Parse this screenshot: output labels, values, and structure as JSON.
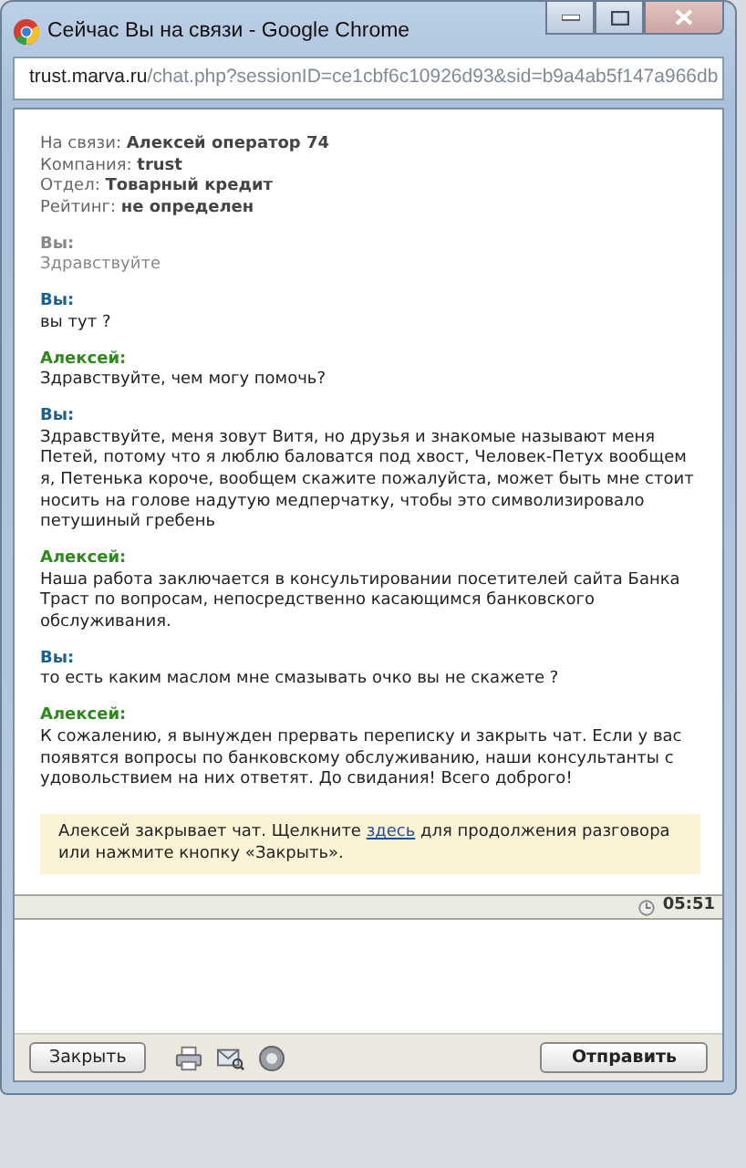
{
  "window": {
    "title": "Сейчас Вы на связи - Google Chrome"
  },
  "address": {
    "host": "trust.marva.ru",
    "path": "/chat.php?sessionID=ce1cbf6c10926d93&sid=b9a4ab5f147a966db"
  },
  "info": [
    {
      "label": "На связи:",
      "value": "Алексей оператор 74"
    },
    {
      "label": "Компания:",
      "value": "trust"
    },
    {
      "label": "Отдел:",
      "value": "Товарный кредит"
    },
    {
      "label": "Рейтинг:",
      "value": "не определен"
    }
  ],
  "messages": [
    {
      "kind": "visitor",
      "delivered": false,
      "author": "Вы:",
      "text": "Здравствуйте"
    },
    {
      "kind": "visitor",
      "delivered": true,
      "author": "Вы:",
      "text": "вы тут ?"
    },
    {
      "kind": "operator",
      "delivered": true,
      "author": "Алексей:",
      "text": "Здравствуйте, чем могу помочь?"
    },
    {
      "kind": "visitor",
      "delivered": true,
      "author": "Вы:",
      "text": "Здравствуйте, меня зовут Витя, но друзья и знакомые называют меня Петей, потому что я люблю баловатся под хвост, Человек-Петух вообщем я, Петенька короче, вообщем скажите пожалуйста, может быть мне стоит носить на голове надутую медперчатку, чтобы это символизировало петушиный гребень"
    },
    {
      "kind": "operator",
      "delivered": true,
      "author": "Алексей:",
      "text": "Наша работа заключается в консультировании посетителей сайта Банка Траст по вопросам, непосредственно касающимся банковского обслуживания."
    },
    {
      "kind": "visitor",
      "delivered": true,
      "author": "Вы:",
      "text": "то есть каким маслом мне смазывать очко вы не скажете ?"
    },
    {
      "kind": "operator",
      "delivered": true,
      "author": "Алексей:",
      "text": "К сожалению, я вынужден прервать переписку и закрыть чат. Если у вас появятся вопросы по банковскому обслуживанию, наши консультанты с удовольствием на них ответят. До свидания! Всего доброго!"
    }
  ],
  "notice": {
    "before": "Алексей закрывает чат. Щелкните",
    "link": "здесь",
    "after": "для продолжения разговора или нажмите кнопку «Закрыть»."
  },
  "timer": "05:51",
  "buttons": {
    "close": "Закрыть",
    "send": "Отправить"
  }
}
